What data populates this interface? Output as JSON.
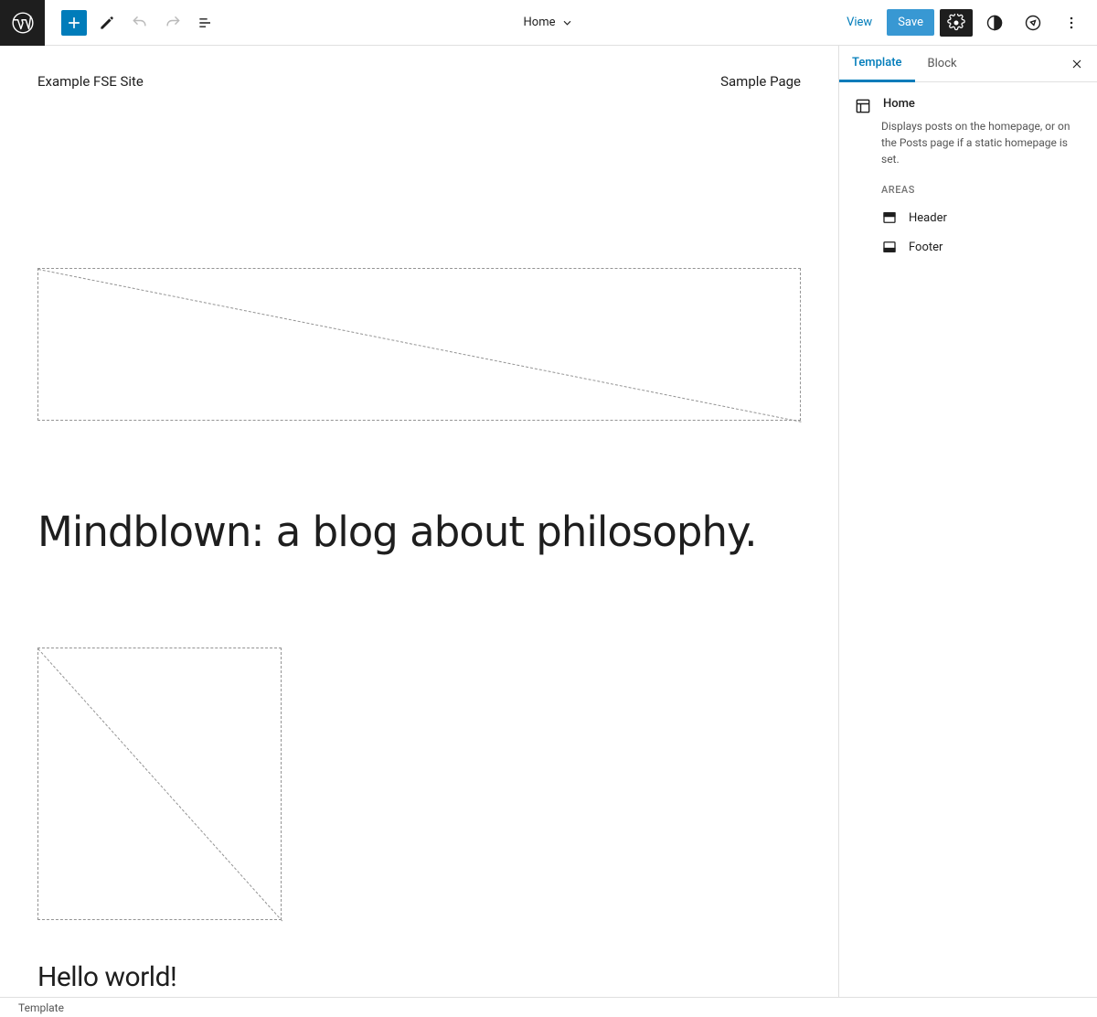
{
  "topbar": {
    "document_label": "Home",
    "view_label": "View",
    "save_label": "Save"
  },
  "canvas": {
    "site_title": "Example FSE Site",
    "nav_link": "Sample Page",
    "heading": "Mindblown: a blog about philosophy.",
    "post_title": "Hello world!"
  },
  "sidebar": {
    "tabs": {
      "template": "Template",
      "block": "Block"
    },
    "template_name": "Home",
    "template_description": "Displays posts on the homepage, or on the Posts page if a static homepage is set.",
    "areas_label": "AREAS",
    "areas": [
      {
        "label": "Header"
      },
      {
        "label": "Footer"
      }
    ]
  },
  "breadcrumb": "Template",
  "colors": {
    "accent": "#007cba",
    "dark": "#1e1e1e"
  }
}
